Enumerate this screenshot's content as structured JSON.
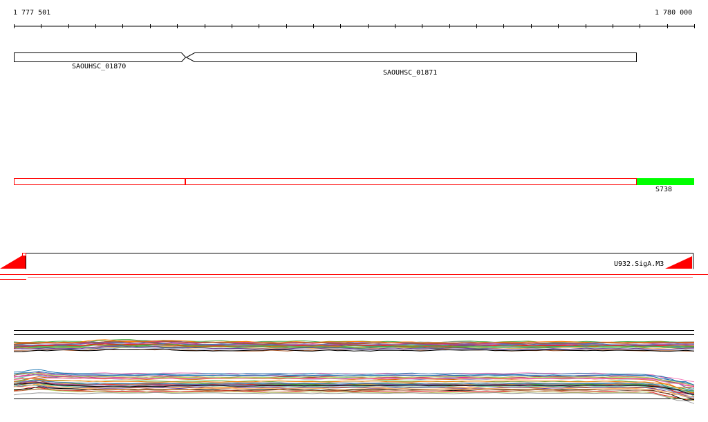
{
  "ruler": {
    "start_label": "1 777 501",
    "end_label": "1 780 000"
  },
  "genes": [
    {
      "name": "SAOUHSC_01870",
      "strand": "+"
    },
    {
      "name": "SAOUHSC_01871",
      "strand": "-"
    }
  ],
  "features": [
    {
      "name": "S738",
      "color": "#00ff00"
    }
  ],
  "coverage_track": {
    "label": "U932.SigA.M3",
    "color": "#ff0000"
  },
  "colors": {
    "axis": "#000000",
    "gene_outline": "#000000",
    "segment_outline": "#ff0000",
    "feature_fill": "#00ff00",
    "coverage": "#ff0000"
  }
}
